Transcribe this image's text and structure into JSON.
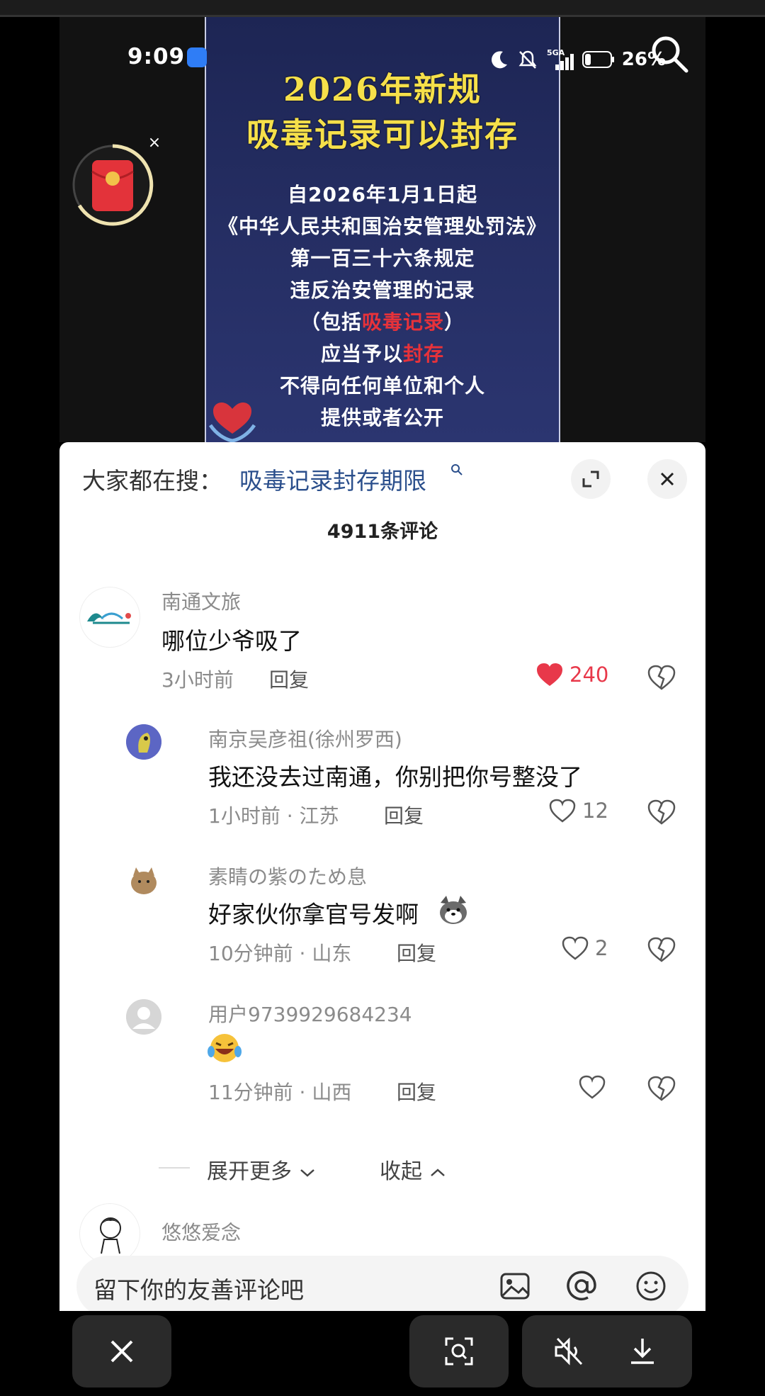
{
  "status_bar": {
    "time": "9:09",
    "network": "5GA",
    "battery": "26%"
  },
  "video": {
    "title_line1": "2026年新规",
    "title_line2": "吸毒记录可以封存",
    "line1": "自2026年1月1日起",
    "line2": "《中华人民共和国治安管理处罚法》",
    "line3": "第一百三十六条规定",
    "line4": "违反治安管理的记录",
    "line5_pre": "（包括",
    "line5_red": "吸毒记录",
    "line5_post": "）",
    "line6_pre": "应当予以",
    "line6_red": "封存",
    "line7": "不得向任何单位和个人",
    "line8": "提供或者公开"
  },
  "sheet": {
    "hot_label": "大家都在搜：",
    "hot_query": "吸毒记录封存期限",
    "comment_count": "4911条评论",
    "comments": [
      {
        "user": "南通文旅",
        "text": "哪位少爷吸了",
        "time": "3小时前",
        "reply": "回复",
        "likes": "240"
      },
      {
        "user": "南京吴彦祖(徐州罗西)",
        "text": "我还没去过南通，你别把你号整没了",
        "time": "1小时前 · 江苏",
        "reply": "回复",
        "likes": "12"
      },
      {
        "user": "素睛の紫のため息",
        "text": "好家伙你拿官号发啊",
        "time": "10分钟前 · 山东",
        "reply": "回复",
        "likes": "2"
      },
      {
        "user": "用户9739929684234",
        "text": "",
        "time": "11分钟前 · 山西",
        "reply": "回复",
        "likes": ""
      },
      {
        "user": "悠悠爱念"
      }
    ],
    "expand_more": "展开更多",
    "collapse": "收起",
    "input_placeholder": "留下你的友善评论吧"
  },
  "colors": {
    "accent_red": "#e8384a",
    "query_blue": "#2b4f8c",
    "poster_bg": "#252e63",
    "poster_title": "#f6e04a"
  }
}
